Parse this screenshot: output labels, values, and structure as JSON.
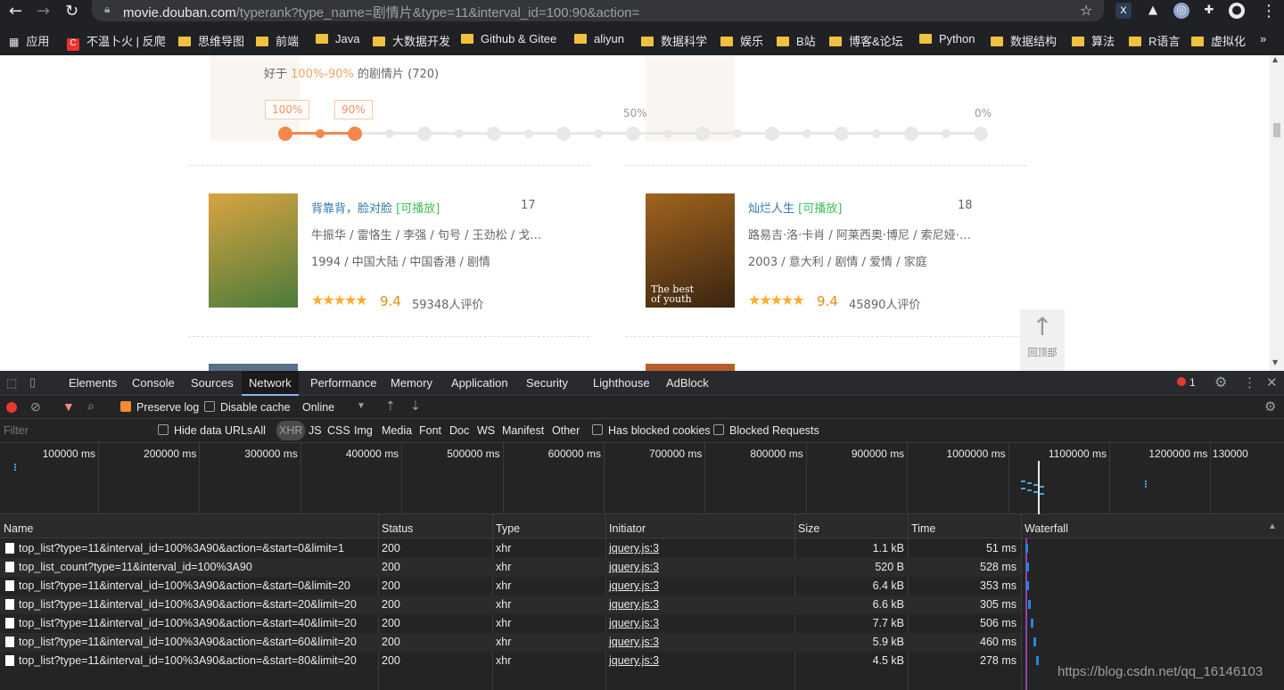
{
  "browser": {
    "url_host": "movie.douban.com",
    "url_rest": "/typerank?type_name=剧情片&type=11&interval_id=100:90&action=",
    "bookmarks": [
      {
        "label": "应用",
        "icon": "apps-icon"
      },
      {
        "label": "不温卜火 | 反爬",
        "icon": "csdn-icon"
      },
      {
        "label": "思维导图",
        "icon": "folder-icon"
      },
      {
        "label": "前端",
        "icon": "folder-icon"
      },
      {
        "label": "Java",
        "icon": "folder-icon"
      },
      {
        "label": "大数据开发",
        "icon": "folder-icon"
      },
      {
        "label": "Github & Gitee",
        "icon": "folder-icon"
      },
      {
        "label": "aliyun",
        "icon": "folder-icon"
      },
      {
        "label": "数据科学",
        "icon": "folder-icon"
      },
      {
        "label": "娱乐",
        "icon": "folder-icon"
      },
      {
        "label": "B站",
        "icon": "folder-icon"
      },
      {
        "label": "博客&论坛",
        "icon": "folder-icon"
      },
      {
        "label": "Python",
        "icon": "folder-icon"
      },
      {
        "label": "数据结构",
        "icon": "folder-icon"
      },
      {
        "label": "算法",
        "icon": "folder-icon"
      },
      {
        "label": "R语言",
        "icon": "folder-icon"
      },
      {
        "label": "虚拟化",
        "icon": "folder-icon"
      }
    ],
    "more_bookmarks": "»"
  },
  "page": {
    "filter_prefix": "好于 ",
    "filter_range": "100%-90%",
    "filter_suffix": " 的剧情片 (720)",
    "slider": {
      "tag_left": "100%",
      "tag_right": "90%",
      "label_mid": "50%",
      "label_end": "0%",
      "range_top": 1.0,
      "range_bottom": 0.9
    },
    "movies": [
      {
        "title": "背靠背，脸对脸",
        "playable": "[可播放]",
        "rank": "17",
        "cast": "牛振华 / 雷恪生 / 李强 / 句号 / 王劲松 / 戈…",
        "info": "1994 / 中国大陆 / 中国香港 / 剧情",
        "stars": "★★★★★",
        "rating": "9.4",
        "votes": "59348人评价",
        "poster_colors": [
          "#d9a441",
          "#4b7b3a"
        ]
      },
      {
        "title": "灿烂人生",
        "playable": "[可播放]",
        "rank": "18",
        "cast": "路易吉·洛·卡肖 / 阿莱西奥·博尼 / 索尼娅·…",
        "info": "2003 / 意大利 / 剧情 / 爱情 / 家庭",
        "stars": "★★★★★",
        "rating": "9.4",
        "votes": "45890人评价",
        "poster_colors": [
          "#a0641e",
          "#3a2410"
        ],
        "poster_caption": "The best of youth"
      }
    ],
    "back_to_top": "回顶部",
    "back_to_top_icon": "arrow-up-icon"
  },
  "devtools": {
    "tabs": [
      "Elements",
      "Console",
      "Sources",
      "Network",
      "Performance",
      "Memory",
      "Application",
      "Security",
      "Lighthouse",
      "AdBlock"
    ],
    "active_tab": "Network",
    "error_count": "1",
    "toolbar": {
      "preserve_log": "Preserve log",
      "disable_cache": "Disable cache",
      "throttle": "Online"
    },
    "filter": {
      "placeholder": "Filter",
      "hide_data_urls": "Hide data URLs",
      "types": [
        "All",
        "XHR",
        "JS",
        "CSS",
        "Img",
        "Media",
        "Font",
        "Doc",
        "WS",
        "Manifest",
        "Other"
      ],
      "active_type": "XHR",
      "has_blocked_cookies": "Has blocked cookies",
      "blocked_requests": "Blocked Requests"
    },
    "timeline_ticks": [
      "100000 ms",
      "200000 ms",
      "300000 ms",
      "400000 ms",
      "500000 ms",
      "600000 ms",
      "700000 ms",
      "800000 ms",
      "900000 ms",
      "1000000 ms",
      "1100000 ms",
      "1200000 ms",
      "130000"
    ],
    "columns": [
      "Name",
      "Status",
      "Type",
      "Initiator",
      "Size",
      "Time",
      "Waterfall"
    ],
    "requests": [
      {
        "name": "top_list?type=11&interval_id=100%3A90&action=&start=0&limit=1",
        "status": "200",
        "type": "xhr",
        "initiator": "jquery.js:3",
        "size": "1.1 kB",
        "time": "51 ms"
      },
      {
        "name": "top_list_count?type=11&interval_id=100%3A90",
        "status": "200",
        "type": "xhr",
        "initiator": "jquery.js:3",
        "size": "520 B",
        "time": "528 ms"
      },
      {
        "name": "top_list?type=11&interval_id=100%3A90&action=&start=0&limit=20",
        "status": "200",
        "type": "xhr",
        "initiator": "jquery.js:3",
        "size": "6.4 kB",
        "time": "353 ms"
      },
      {
        "name": "top_list?type=11&interval_id=100%3A90&action=&start=20&limit=20",
        "status": "200",
        "type": "xhr",
        "initiator": "jquery.js:3",
        "size": "6.6 kB",
        "time": "305 ms"
      },
      {
        "name": "top_list?type=11&interval_id=100%3A90&action=&start=40&limit=20",
        "status": "200",
        "type": "xhr",
        "initiator": "jquery.js:3",
        "size": "7.7 kB",
        "time": "506 ms"
      },
      {
        "name": "top_list?type=11&interval_id=100%3A90&action=&start=60&limit=20",
        "status": "200",
        "type": "xhr",
        "initiator": "jquery.js:3",
        "size": "5.9 kB",
        "time": "460 ms"
      },
      {
        "name": "top_list?type=11&interval_id=100%3A90&action=&start=80&limit=20",
        "status": "200",
        "type": "xhr",
        "initiator": "jquery.js:3",
        "size": "4.5 kB",
        "time": "278 ms"
      }
    ]
  },
  "watermark": "https://blog.csdn.net/qq_16146103",
  "colors": {
    "accent": "#f4874c",
    "link": "#3377aa",
    "devtools_bg": "#242424"
  }
}
